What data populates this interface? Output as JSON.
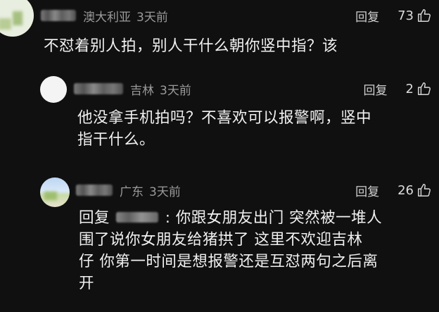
{
  "comments": [
    {
      "region": "澳大利亚",
      "time": "3天前",
      "reply_label": "回复",
      "likes": "73",
      "text": "不怼着别人拍，别人干什么朝你竖中指？该"
    },
    {
      "region": "吉林",
      "time": "3天前",
      "reply_label": "回复",
      "likes": "2",
      "text_line1": "他没拿手机拍吗？不喜欢可以报警啊，竖中",
      "text_line2": "指干什么。"
    },
    {
      "region": "广东",
      "time": "3天前",
      "reply_label": "回复",
      "likes": "26",
      "reply_prefix": "回复",
      "text_line1_rest": ": 你跟女朋友出门 突然被一堆人",
      "text_line2": "围了说你女朋友给猪拱了 这里不欢迎吉林",
      "text_line3": "仔 你第一时间是想报警还是互怼两句之后离",
      "text_line4": "开"
    }
  ],
  "colors": {
    "background": "#101010",
    "text": "#f1f1f1",
    "meta": "#9a9a9a"
  },
  "icons": [
    "thumbs-up-icon"
  ]
}
